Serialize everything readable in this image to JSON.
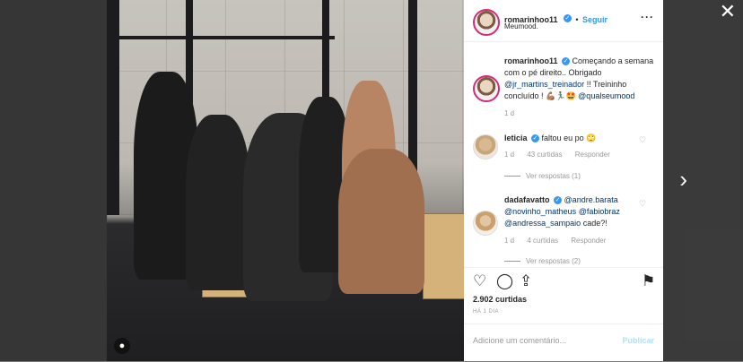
{
  "overlay": {
    "close_icon": "close-icon",
    "next_icon": "chevron-right-icon"
  },
  "post": {
    "author": "romarinhoo11",
    "follow_label": "Seguir",
    "location": "Meumood.",
    "more_icon": "more-options-icon",
    "caption": {
      "author": "romarinhoo11",
      "text_1": "Começando a semana com o pé direito.. Obrigado",
      "mention_1": "@jr_martins_treinador",
      "text_2": "!! Treininho concluído ! 💪🏽🏃🏽‍♂️🤩",
      "mention_2": "@qualseumood",
      "time": "1 d"
    },
    "comments": [
      {
        "author": "leticia",
        "text": "faltou eu po 🙄",
        "time": "1 d",
        "likes": "43 curtidas",
        "reply_label": "Responder",
        "view_replies": "Ver respostas (1)"
      },
      {
        "author": "dadafavatto",
        "mention_1": "@andre.barata",
        "mention_2": "@novinho_matheus",
        "mention_3": "@fabiobraz",
        "mention_4": "@andressa_sampaio",
        "text": "cade?!",
        "time": "1 d",
        "likes": "4 curtidas",
        "reply_label": "Responder",
        "view_replies": "Ver respostas (2)"
      }
    ],
    "likes_count": "2.902 curtidas",
    "posted_ago": "HÁ 1 DIA",
    "comment_placeholder": "Adicione um comentário...",
    "publish_label": "Publicar"
  },
  "colors": {
    "accent": "#3897f0",
    "link": "#003569",
    "muted": "#999999"
  }
}
